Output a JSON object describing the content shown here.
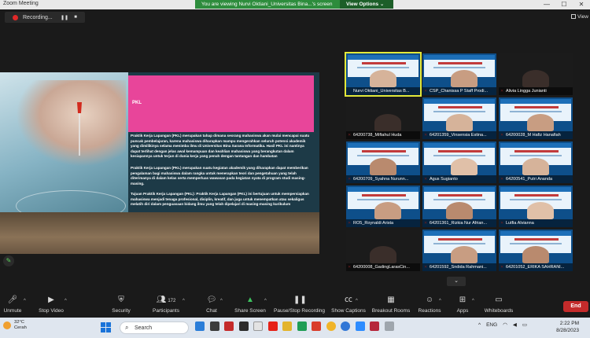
{
  "window": {
    "title": "Zoom Meeting",
    "controls": [
      "—",
      "☐",
      "✕"
    ]
  },
  "banner": {
    "text": "You are viewing Nurvi Oktiani_Universitas Bina...'s screen",
    "options_label": "View Options ⌄"
  },
  "recording": {
    "label": "Recording...",
    "pause_symbol": "❚❚",
    "stop_symbol": "■"
  },
  "view_button": {
    "label": "View"
  },
  "slide": {
    "title": "PKL",
    "paragraph1": "Praktik Kerja Lapangan (PKL) merupakan tahap dimana seorang mahasiswa akan mulai mencapai suatu puncak pembelajaran, karena mahasiswa diharapkan mampu mengerahkan seluruh potensi akademik yang dimilikinya selama menimba ilmu di Universitas Bina Sarana Informatika. Hasil PKL ini nantinya dapat terlihat dengan jelas awal kemampuan dan keahlian mahasiswa yang berangkutan dalam kesiapannya untuk terjun di dunia kerja yang penuh dengan tantangan dan hambatan",
    "paragraph2": "Praktik Kerja Lapangan (PKL) merupakan suatu kegiatan akademik yang diharapkan dapat memberikan pengalaman bagi mahasiswa dalam rangka untuk menerapkan teori dan pengetahuan yang telah diterimanya di dalam kelas serta memperluas wawasan pada kegiatan nyata di program studi masing-masing.",
    "paragraph3": "Tujuan Praktik Kerja Lapangan (PKL): Praktik Kerja Lapangan (PKL) ini bertujuan untuk mempersiapkan mahasiswa menjadi tenaga profesional, disiplin, kreatif, dan juga untuk menempatkan atau sekaligus melatih diri dalam penguasaan bidang ilmu yang telah dipelajari di masing-masing kurikulum"
  },
  "gallery": {
    "participants": [
      {
        "name": "Nurvi Oktiani_Universitas B...",
        "muted": false,
        "type": "slide",
        "active": true
      },
      {
        "name": "CSP_Chanissa P Staff Prodi...",
        "muted": true,
        "type": "slide",
        "active": false
      },
      {
        "name": "Alivia Lingga Junianti",
        "muted": true,
        "type": "dark",
        "active": false
      },
      {
        "name": "64200738_Miftahul Huda",
        "muted": true,
        "type": "dark",
        "active": false
      },
      {
        "name": "64201359_Vinsensia Estina...",
        "muted": true,
        "type": "slide",
        "active": false
      },
      {
        "name": "64200028_M Hafiz Hanafiah",
        "muted": true,
        "type": "slide",
        "active": false
      },
      {
        "name": "64200709_Syahna Nurunn...",
        "muted": true,
        "type": "slide",
        "active": false
      },
      {
        "name": "Agus Sugianto",
        "muted": true,
        "type": "slide",
        "active": false
      },
      {
        "name": "64200541_Putri Ananda",
        "muted": true,
        "type": "slide",
        "active": false
      },
      {
        "name": "RO5_Roynaldi Arista",
        "muted": true,
        "type": "slide",
        "active": false
      },
      {
        "name": "64201361_Rizkia Nur Afrian...",
        "muted": true,
        "type": "slide",
        "active": false
      },
      {
        "name": "Lutfia Alvianna",
        "muted": true,
        "type": "slide",
        "active": false
      },
      {
        "name": "64200008_GadingLarasCin...",
        "muted": true,
        "type": "dark",
        "active": false
      },
      {
        "name": "64201592_Sndida Rahmani...",
        "muted": true,
        "type": "slide",
        "active": false
      },
      {
        "name": "64201052_ERIKA SAHRANI...",
        "muted": true,
        "type": "slide",
        "active": false
      }
    ],
    "more_icon": "⌄"
  },
  "toolbar": {
    "unmute": "Unmute",
    "stop_video": "Stop Video",
    "security": "Security",
    "participants": "Participants",
    "participant_count": "172",
    "chat": "Chat",
    "share_screen": "Share Screen",
    "pause_stop_recording": "Pause/Stop Recording",
    "show_captions": "Show Captions",
    "breakout_rooms": "Breakout Rooms",
    "reactions": "Reactions",
    "apps": "Apps",
    "whiteboards": "Whiteboards",
    "end": "End"
  },
  "taskbar": {
    "weather_temp": "32°C",
    "weather_desc": "Cerah",
    "search_placeholder": "Search",
    "language": "ENG",
    "time": "2:22 PM",
    "date": "8/28/2023"
  },
  "colors": {
    "accent_green": "#2d8c3c",
    "pink": "#e8459a",
    "end_red": "#c42b2b",
    "active_outline": "#e3e83a"
  }
}
